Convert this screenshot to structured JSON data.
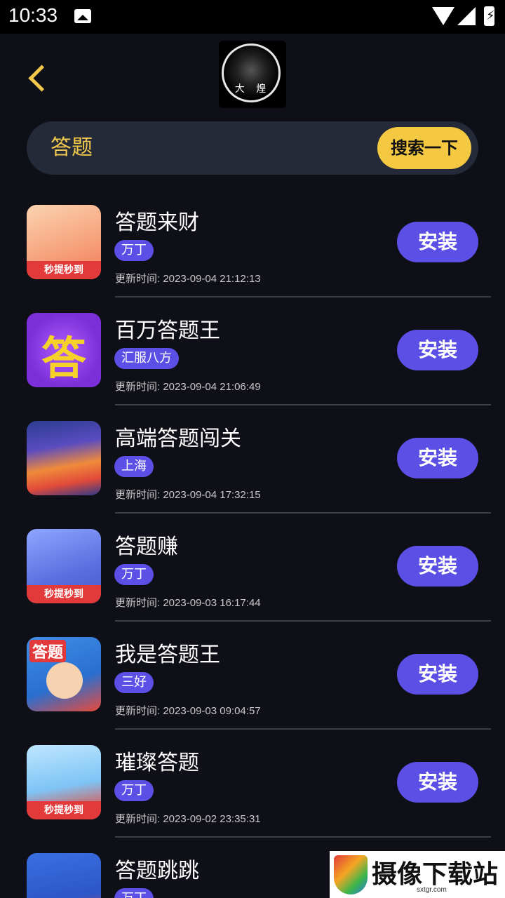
{
  "status_bar": {
    "time": "10:33",
    "battery_glyph": "⚡"
  },
  "header": {
    "logo_text": "大 煌"
  },
  "search": {
    "query": "答题",
    "button_label": "搜索一下"
  },
  "install_label": "安装",
  "time_prefix": "更新时间: ",
  "apps": [
    {
      "name": "答题来财",
      "tag": "万丁",
      "updated": "2023-09-04 21:12:13",
      "badge": "秒提秒到",
      "icon": "paper-hand-icon"
    },
    {
      "name": "百万答题王",
      "tag": "汇服八方",
      "updated": "2023-09-04 21:06:49",
      "badge": "",
      "icon": "answer-badge-icon",
      "icon_char": "答"
    },
    {
      "name": "高端答题闯关",
      "tag": "上海",
      "updated": "2023-09-04 17:32:15",
      "badge": "",
      "icon": "sunset-landscape-icon"
    },
    {
      "name": "答题赚",
      "tag": "万丁",
      "updated": "2023-09-03 16:17:44",
      "badge": "秒提秒到",
      "icon": "student-pencil-icon"
    },
    {
      "name": "我是答题王",
      "tag": "三好",
      "updated": "2023-09-03 09:04:57",
      "badge": "",
      "icon": "cartoon-man-icon",
      "icon_char": "答题"
    },
    {
      "name": "璀璨答题",
      "tag": "万丁",
      "updated": "2023-09-02 23:35:31",
      "badge": "秒提秒到",
      "icon": "rocket-rider-icon"
    },
    {
      "name": "答题跳跳",
      "tag": "万丁",
      "updated": "",
      "badge": "",
      "icon": "coins-pencil-icon"
    }
  ],
  "watermark": {
    "text": "摄像下载站",
    "url": "sxtgr.com"
  },
  "colors": {
    "accent_yellow": "#f5c842",
    "accent_purple": "#5b4fe6",
    "background": "#0e0f17"
  }
}
